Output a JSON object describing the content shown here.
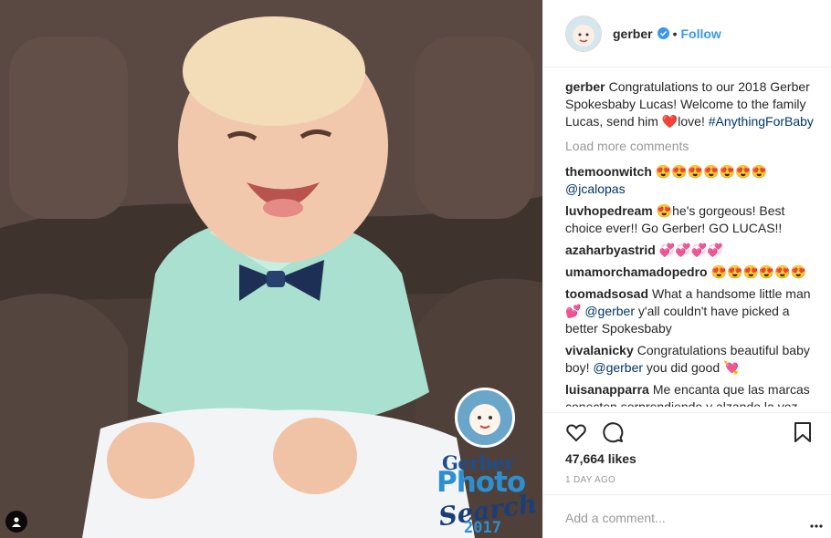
{
  "post": {
    "username": "gerber",
    "follow_label": "Follow",
    "dot": "•",
    "caption": {
      "text_before": "Congratulations to our 2018 Gerber Spokesbaby Lucas! Welcome to the family Lucas, send him ",
      "emoji": "❤️‍",
      "text_after": "love! ",
      "hashtag": "#AnythingForBaby"
    },
    "load_more": "Load more comments",
    "comments": [
      {
        "user": "themoonwitch",
        "text": "😍😍😍😍😍😍😍 ",
        "mention": "@jcalopas",
        "text2": ""
      },
      {
        "user": "luvhopedream",
        "text": "😍he's gorgeous! Best choice ever!! Go Gerber! GO LUCAS!!",
        "mention": "",
        "text2": ""
      },
      {
        "user": "azaharbyastrid",
        "text": "💞💞💞💞",
        "mention": "",
        "text2": ""
      },
      {
        "user": "umamorchamadopedro",
        "text": "😍😍😍😍😍😍",
        "mention": "",
        "text2": ""
      },
      {
        "user": "toomadsosad",
        "text": "What a handsome little man 💕 ",
        "mention": "@gerber",
        "text2": " y'all couldn't have picked a better Spokesbaby"
      },
      {
        "user": "vivalanicky",
        "text": "Congratulations beautiful baby boy! ",
        "mention": "@gerber",
        "text2": " you did good 💘"
      },
      {
        "user": "luisanapparra",
        "text": "Me encanta que las marcas conecten sorprendiendo y alzando la voz ♥★★★★★★★",
        "mention": "",
        "text2": ""
      }
    ],
    "likes": "47,664 likes",
    "time": "1 DAY AGO",
    "comment_placeholder": "Add a comment..."
  },
  "photo_badge": {
    "brand": "Gerber",
    "word1": "Photo",
    "word2": "Search",
    "year": "2017"
  },
  "icons": {
    "like": "heart-icon",
    "comment": "comment-bubble-icon",
    "save": "bookmark-icon",
    "more": "more-options-icon",
    "verified": "verified-badge-icon",
    "user_tag": "user-tag-icon"
  },
  "colors": {
    "accent": "#3897f0",
    "link": "#003569",
    "muted": "#999999",
    "border": "#efefef"
  }
}
